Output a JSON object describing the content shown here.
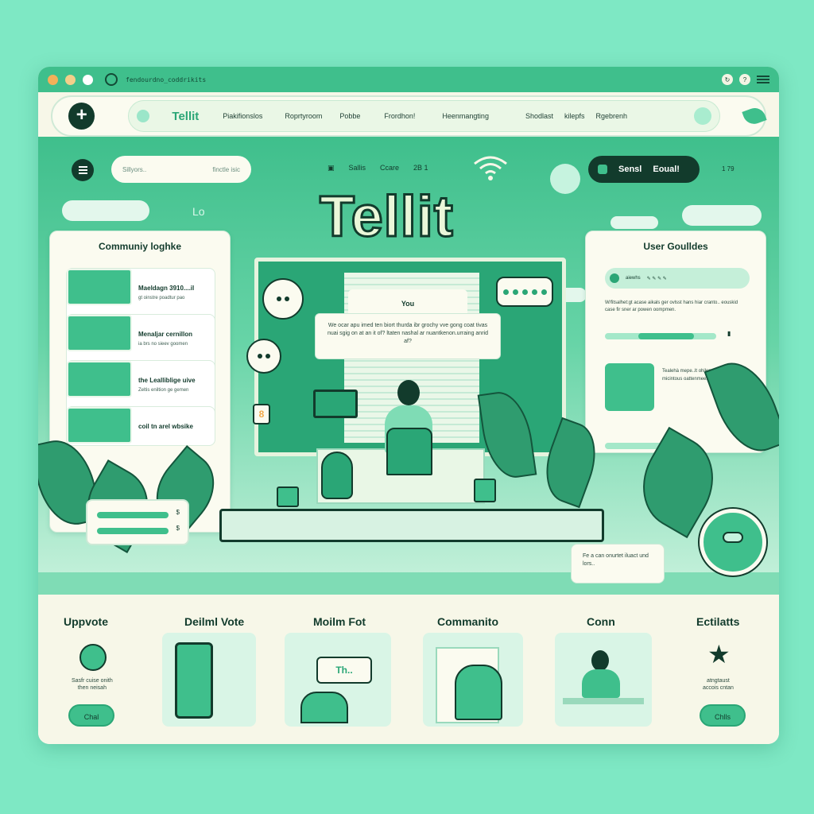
{
  "titlebar": {
    "url": "fendourdno_coddrikits",
    "dot_colors": [
      "#f3b05a",
      "#f3cf8a",
      "#ffffff"
    ]
  },
  "nav": {
    "logo": "Tellit",
    "links": [
      "Piakifionslos",
      "Roprtyroom",
      "Pobbe",
      "Frordhon!",
      "Heenmangting",
      "Shodlast",
      "kilepfs",
      "Rgebrenh"
    ]
  },
  "hero": {
    "search_placeholder": "Sillyors..",
    "search_hint": "finctle isic",
    "meta_left": "Sallis",
    "meta_mid": "Ccare",
    "meta_right": "2B 1",
    "signal_label": "Sensl",
    "signal_value": "Eoual!",
    "time": "1 79",
    "lo_label": "Lo",
    "brand": "Tellit"
  },
  "community": {
    "title": "Communiy loghke",
    "items": [
      {
        "title": "Maeldagn 3910....il",
        "sub": "gt oinstre poadtur pao"
      },
      {
        "title": "Menaljar cernillon",
        "sub": "ia brs no sieev goomen"
      },
      {
        "title": "the Lealliblige uive",
        "sub": "Zeltis eniltion ge gemen"
      },
      {
        "title": "coil tn arel wbsike",
        "sub": ""
      }
    ]
  },
  "guides": {
    "title": "User Goulldes",
    "tab_label": "aiewhs",
    "text": "W/fitsalhet:gt acase aikals ger ovlsst hans hiar cranto.. eouskid case fir sner ar powen oompmen.",
    "card_text": "Tealehà mepe..lt ohilen.. Siee:wisst micintous oattenmeese dabiir."
  },
  "scene": {
    "you_label": "You",
    "chat_text": "We ocar apu imed ten biort thurda ibr grochy vve gong coat tivas nuai sgig on at an it of? ltaten nashal ar nuantkenon.urraing anrid af?",
    "note_text": "Fe a can onurtet iluact und lors..",
    "number_badge": "8"
  },
  "features": [
    {
      "title": "Uppvote",
      "text": "Sasfr cuise onith\nthen neisah",
      "button": "Chal"
    },
    {
      "title": "Deilml Vote",
      "text": "",
      "button": ""
    },
    {
      "title": "Moilm  Fot",
      "text": "",
      "button": ""
    },
    {
      "title": "Commanito",
      "text": "",
      "button": ""
    },
    {
      "title": "Conn",
      "text": "",
      "button": ""
    },
    {
      "title": "Ectilatts",
      "text": "atngtaust\naccois cntan",
      "button": "Chlls"
    }
  ],
  "colors": {
    "accent": "#3fbf8c",
    "dark": "#123b2c",
    "paper": "#f7f7e8"
  }
}
